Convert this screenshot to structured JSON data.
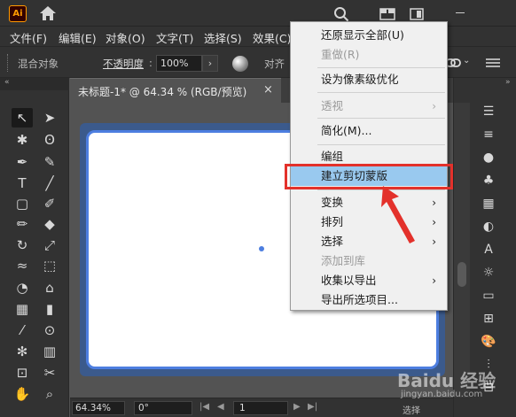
{
  "titlebar": {
    "logo": "Ai",
    "icons": [
      "home-icon",
      "search-icon",
      "workspace-icon",
      "panel-icon",
      "minimize-icon"
    ]
  },
  "menubar": {
    "items": [
      "文件(F)",
      "编辑(E)",
      "对象(O)",
      "文字(T)",
      "选择(S)",
      "效果(C)"
    ]
  },
  "controlbar": {
    "blend_label": "混合对象",
    "opacity_label": "不透明度",
    "opacity_value": "100%",
    "align_label": "对齐"
  },
  "document": {
    "tab_title": "未标题-1* @ 64.34 % (RGB/预览)",
    "close": "×",
    "zoom": "64.34%",
    "rotation": "0°",
    "page": "1"
  },
  "context_menu": {
    "items": [
      {
        "label": "还原显示全部(U)",
        "disabled": false,
        "submenu": false
      },
      {
        "label": "重做(R)",
        "disabled": true,
        "submenu": false
      },
      {
        "label": "设为像素级优化",
        "disabled": false,
        "submenu": false
      },
      {
        "label": "透视",
        "disabled": true,
        "submenu": true
      },
      {
        "label": "简化(M)...",
        "disabled": false,
        "submenu": false
      },
      {
        "label": "编组",
        "disabled": false,
        "submenu": false
      },
      {
        "label": "建立剪切蒙版",
        "disabled": false,
        "submenu": false,
        "highlighted": true
      },
      {
        "label": "变换",
        "disabled": false,
        "submenu": true
      },
      {
        "label": "排列",
        "disabled": false,
        "submenu": true
      },
      {
        "label": "选择",
        "disabled": false,
        "submenu": true
      },
      {
        "label": "添加到库",
        "disabled": true,
        "submenu": false
      },
      {
        "label": "收集以导出",
        "disabled": false,
        "submenu": true
      },
      {
        "label": "导出所选项目...",
        "disabled": false,
        "submenu": false
      }
    ]
  },
  "watermark": {
    "text": "Baidu 经验",
    "sub": "jingyan.baidu.com"
  },
  "status_right": "选择",
  "colors": {
    "highlight": "#99c9ef",
    "annotation": "#e3312b",
    "selection": "#4d7ee0",
    "ui_dark": "#323232"
  }
}
